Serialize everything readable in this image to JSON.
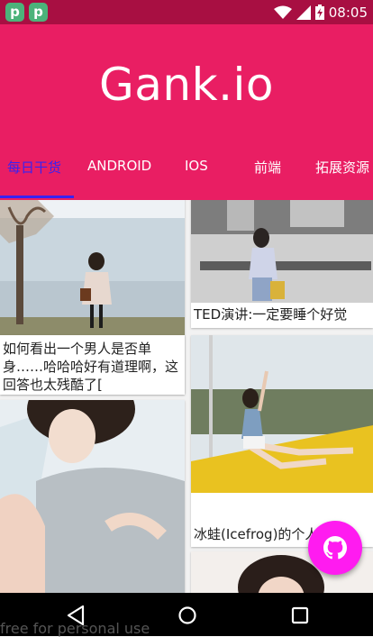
{
  "status_bar": {
    "time": "08:05",
    "left_icons": [
      "p-app-icon",
      "p-app-icon"
    ],
    "right_icons": [
      "wifi-icon",
      "cell-signal-icon",
      "battery-charging-icon"
    ]
  },
  "app_bar": {
    "title": "Gank.io",
    "color": "#e91e63"
  },
  "tabs": [
    {
      "label": "每日干货",
      "active": true
    },
    {
      "label": "ANDROID",
      "active": false
    },
    {
      "label": "IOS",
      "active": false
    },
    {
      "label": "前端",
      "active": false
    },
    {
      "label": "拓展资源",
      "active": false
    }
  ],
  "feed": {
    "cards": [
      {
        "caption": ""
      },
      {
        "caption": "如何看出一个男人是否单身……哈哈哈好有道理啊，这回答也太残酷了["
      },
      {
        "caption": "TED演讲:一定要睡个好觉"
      },
      {
        "caption": "冰蛙(Icefrog)的个人"
      },
      {
        "caption": ""
      },
      {
        "caption": ""
      }
    ]
  },
  "fab": {
    "icon": "github-icon",
    "color": "#ff1bf0"
  },
  "nav_bar": {
    "icons": [
      "back-icon",
      "home-icon",
      "recents-icon"
    ]
  },
  "watermark": "free for personal use"
}
